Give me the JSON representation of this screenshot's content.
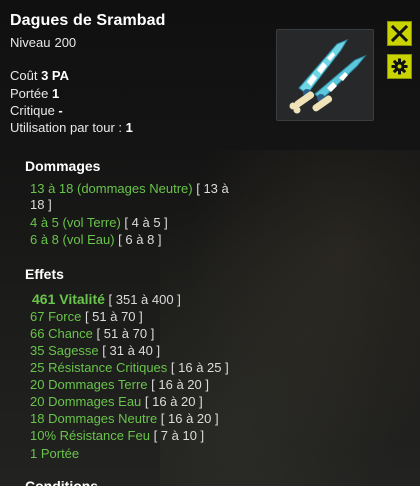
{
  "item": {
    "name": "Dagues de Srambad",
    "level_label": "Niveau",
    "level_value": "200"
  },
  "stats": {
    "cost_label": "Coût",
    "cost_value": "3 PA",
    "range_label": "Portée",
    "range_value": "1",
    "crit_label": "Critique",
    "crit_value": "-",
    "uses_label": "Utilisation par tour :",
    "uses_value": "1"
  },
  "damages": {
    "header": "Dommages",
    "lines": [
      {
        "value": "13 à 18 (dommages Neutre)",
        "range": "[ 13 à",
        "range2": "18 ]"
      },
      {
        "value": "4 à 5 (vol Terre)",
        "range": "[ 4 à 5 ]"
      },
      {
        "value": "6 à 8 (vol Eau)",
        "range": "[ 6 à 8 ]"
      }
    ]
  },
  "effects": {
    "header": "Effets",
    "lines": [
      {
        "value": "461 Vitalité",
        "range": "[ 351 à 400 ]"
      },
      {
        "value": "67 Force",
        "range": "[ 51 à 70 ]"
      },
      {
        "value": "66 Chance",
        "range": "[ 51 à 70 ]"
      },
      {
        "value": "35 Sagesse",
        "range": "[ 31 à 40 ]"
      },
      {
        "value": "25 Résistance Critiques",
        "range": "[ 16 à 25 ]"
      },
      {
        "value": "20 Dommages Terre",
        "range": "[ 16 à 20 ]"
      },
      {
        "value": "20 Dommages Eau",
        "range": "[ 16 à 20 ]"
      },
      {
        "value": "18 Dommages Neutre",
        "range": "[ 16 à 20 ]"
      },
      {
        "value": "10% Résistance Feu",
        "range": "[ 7 à 10 ]"
      },
      {
        "value": "1 Portée",
        "range": ""
      }
    ]
  },
  "conditions": {
    "header": "Conditions"
  },
  "icons": {
    "close": "close-icon",
    "settings": "gear-icon",
    "item": "daggers-item-icon"
  },
  "colors": {
    "effect_green": "#69c44b",
    "button_yellow": "#c8d300"
  }
}
